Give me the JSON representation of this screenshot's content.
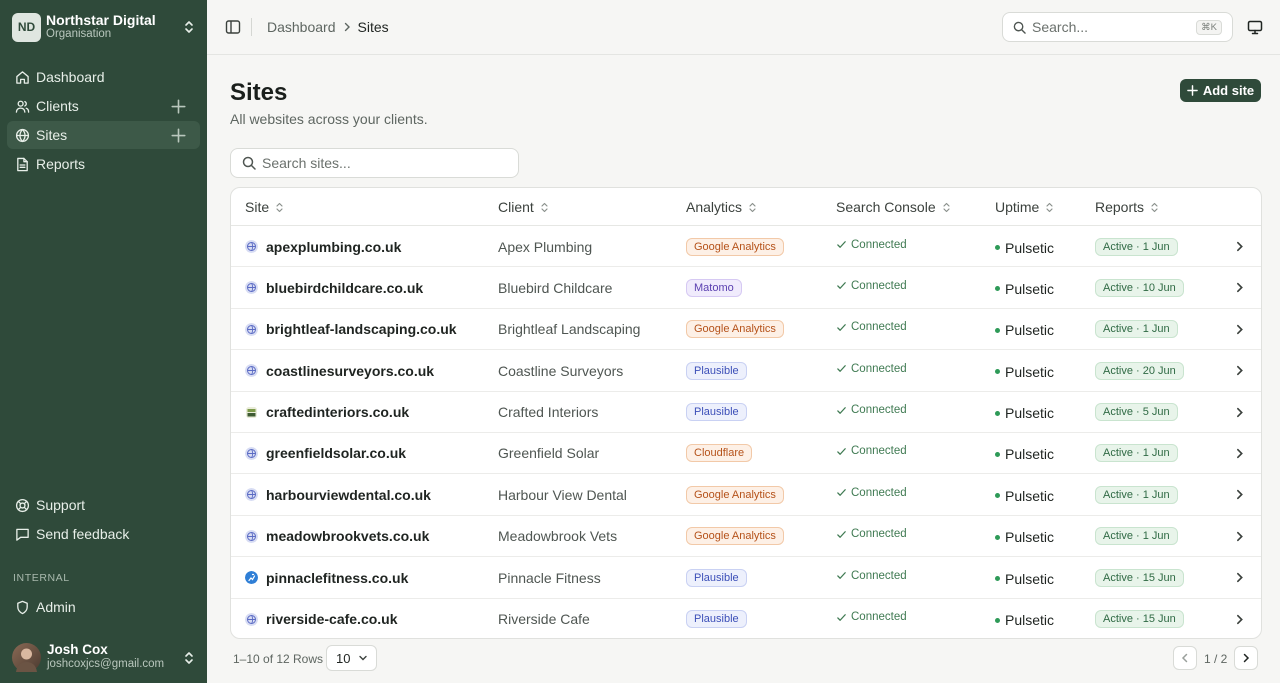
{
  "org": {
    "initials": "ND",
    "name": "Northstar Digital",
    "subtitle": "Organisation"
  },
  "nav": [
    {
      "label": "Dashboard",
      "icon": "home-icon",
      "active": false,
      "add": false
    },
    {
      "label": "Clients",
      "icon": "users-icon",
      "active": false,
      "add": true
    },
    {
      "label": "Sites",
      "icon": "globe-icon",
      "active": true,
      "add": true
    },
    {
      "label": "Reports",
      "icon": "document-icon",
      "active": false,
      "add": false
    }
  ],
  "bottom_nav": [
    {
      "label": "Support",
      "icon": "lifebuoy-icon"
    },
    {
      "label": "Send feedback",
      "icon": "message-icon"
    }
  ],
  "internal": {
    "section_label": "INTERNAL",
    "admin_label": "Admin"
  },
  "user": {
    "name": "Josh Cox",
    "email": "joshcoxjcs@gmail.com"
  },
  "topbar": {
    "breadcrumb_root": "Dashboard",
    "breadcrumb_current": "Sites",
    "search_placeholder": "Search...",
    "search_shortcut": "⌘K"
  },
  "page": {
    "title": "Sites",
    "subtitle": "All websites across your clients.",
    "add_label": "Add site",
    "search_placeholder": "Search sites..."
  },
  "table": {
    "columns": [
      "Site",
      "Client",
      "Analytics",
      "Search Console",
      "Uptime",
      "Reports"
    ],
    "rows": [
      {
        "site": "apexplumbing.co.uk",
        "client": "Apex Plumbing",
        "analytics": "Google Analytics",
        "console": "Connected",
        "uptime": "Pulsetic",
        "reports": "Active · 1 Jun",
        "favicon": "globe"
      },
      {
        "site": "bluebirdchildcare.co.uk",
        "client": "Bluebird Childcare",
        "analytics": "Matomo",
        "console": "Connected",
        "uptime": "Pulsetic",
        "reports": "Active · 10 Jun",
        "favicon": "globe"
      },
      {
        "site": "brightleaf-landscaping.co.uk",
        "client": "Brightleaf Landscaping",
        "analytics": "Google Analytics",
        "console": "Connected",
        "uptime": "Pulsetic",
        "reports": "Active · 1 Jun",
        "favicon": "globe"
      },
      {
        "site": "coastlinesurveyors.co.uk",
        "client": "Coastline Surveyors",
        "analytics": "Plausible",
        "console": "Connected",
        "uptime": "Pulsetic",
        "reports": "Active · 20 Jun",
        "favicon": "globe"
      },
      {
        "site": "craftedinteriors.co.uk",
        "client": "Crafted Interiors",
        "analytics": "Plausible",
        "console": "Connected",
        "uptime": "Pulsetic",
        "reports": "Active · 5 Jun",
        "favicon": "crafted"
      },
      {
        "site": "greenfieldsolar.co.uk",
        "client": "Greenfield Solar",
        "analytics": "Cloudflare",
        "console": "Connected",
        "uptime": "Pulsetic",
        "reports": "Active · 1 Jun",
        "favicon": "globe"
      },
      {
        "site": "harbourviewdental.co.uk",
        "client": "Harbour View Dental",
        "analytics": "Google Analytics",
        "console": "Connected",
        "uptime": "Pulsetic",
        "reports": "Active · 1 Jun",
        "favicon": "globe"
      },
      {
        "site": "meadowbrookvets.co.uk",
        "client": "Meadowbrook Vets",
        "analytics": "Google Analytics",
        "console": "Connected",
        "uptime": "Pulsetic",
        "reports": "Active · 1 Jun",
        "favicon": "globe"
      },
      {
        "site": "pinnaclefitness.co.uk",
        "client": "Pinnacle Fitness",
        "analytics": "Plausible",
        "console": "Connected",
        "uptime": "Pulsetic",
        "reports": "Active · 15 Jun",
        "favicon": "runner"
      },
      {
        "site": "riverside-cafe.co.uk",
        "client": "Riverside Cafe",
        "analytics": "Plausible",
        "console": "Connected",
        "uptime": "Pulsetic",
        "reports": "Active · 15 Jun",
        "favicon": "globe"
      }
    ]
  },
  "analytics_colors": {
    "Google Analytics": {
      "text": "#b5521a",
      "bg": "#fdf0e6",
      "border": "#f2c9a8"
    },
    "Matomo": {
      "text": "#5a3fb0",
      "bg": "#f0ebfc",
      "border": "#d6c9f3"
    },
    "Plausible": {
      "text": "#3c4fb8",
      "bg": "#edf0fc",
      "border": "#c9d1f3"
    },
    "Cloudflare": {
      "text": "#b5521a",
      "bg": "#fdf0e6",
      "border": "#f2c9a8"
    }
  },
  "footer": {
    "count": "1–10 of 12",
    "rows_label": "Rows",
    "rows_value": "10",
    "page": "1 / 2"
  }
}
